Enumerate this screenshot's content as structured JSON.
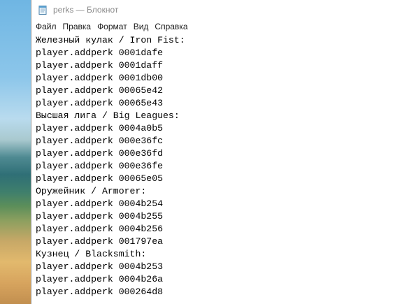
{
  "window": {
    "title": "perks — Блокнот",
    "icon": "notepad-icon"
  },
  "menu": [
    "Файл",
    "Правка",
    "Формат",
    "Вид",
    "Справка"
  ],
  "editor": {
    "lines": [
      "Железный кулак / Iron Fist:",
      "player.addperk 0001dafe",
      "player.addperk 0001daff",
      "player.addperk 0001db00",
      "player.addperk 00065e42",
      "player.addperk 00065e43",
      "Высшая лига / Big Leagues:",
      "player.addperk 0004a0b5",
      "player.addperk 000e36fc",
      "player.addperk 000e36fd",
      "player.addperk 000e36fe",
      "player.addperk 00065e05",
      "Оружейник / Armorer:",
      "player.addperk 0004b254",
      "player.addperk 0004b255",
      "player.addperk 0004b256",
      "player.addperk 001797ea",
      "Кузнец / Blacksmith:",
      "player.addperk 0004b253",
      "player.addperk 0004b26a",
      "player.addperk 000264d8"
    ]
  }
}
